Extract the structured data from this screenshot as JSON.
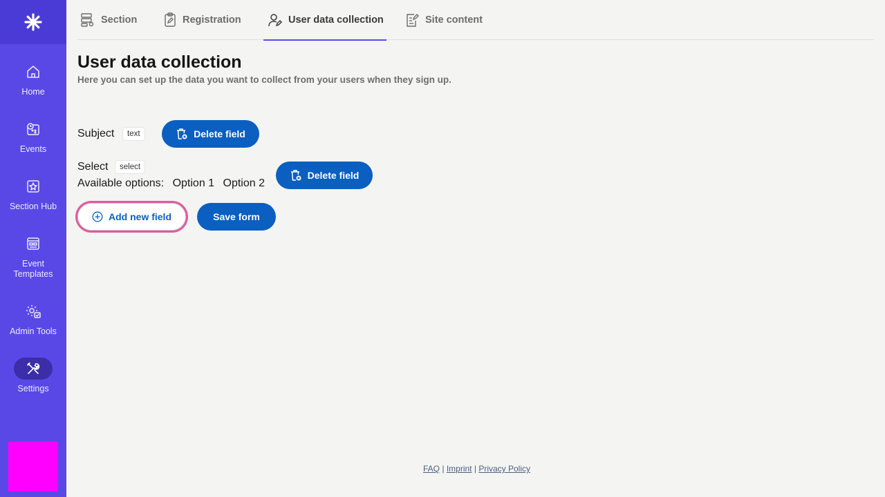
{
  "sidebar": {
    "items": [
      {
        "label": "Home",
        "icon": "home-icon"
      },
      {
        "label": "Events",
        "icon": "events-icon"
      },
      {
        "label": "Section Hub",
        "icon": "section-hub-icon"
      },
      {
        "label": "Event Templates",
        "icon": "event-templates-icon"
      },
      {
        "label": "Admin Tools",
        "icon": "admin-tools-icon"
      },
      {
        "label": "Settings",
        "icon": "settings-icon",
        "active": true
      }
    ],
    "accent": "#5a48e6"
  },
  "tabs": [
    {
      "label": "Section",
      "icon": "section-icon"
    },
    {
      "label": "Registration",
      "icon": "registration-icon"
    },
    {
      "label": "User data collection",
      "icon": "user-data-icon",
      "active": true
    },
    {
      "label": "Site content",
      "icon": "site-content-icon"
    }
  ],
  "page": {
    "title": "User data collection",
    "subtitle": "Here you can set up the data you want to collect from your users when they sign up."
  },
  "fields": [
    {
      "name": "Subject",
      "type": "text",
      "delete_label": "Delete field"
    },
    {
      "name": "Select",
      "type": "select",
      "options_label": "Available options:",
      "options": [
        "Option 1",
        "Option 2"
      ],
      "delete_label": "Delete field"
    }
  ],
  "actions": {
    "add_label": "Add new field",
    "save_label": "Save form"
  },
  "footer": {
    "links": [
      "FAQ",
      "Imprint",
      "Privacy Policy"
    ],
    "separator": "|"
  },
  "colors": {
    "primary_button": "#0a5fc0",
    "focus_ring": "#e05aa0",
    "avatar": "#ff00ff"
  }
}
